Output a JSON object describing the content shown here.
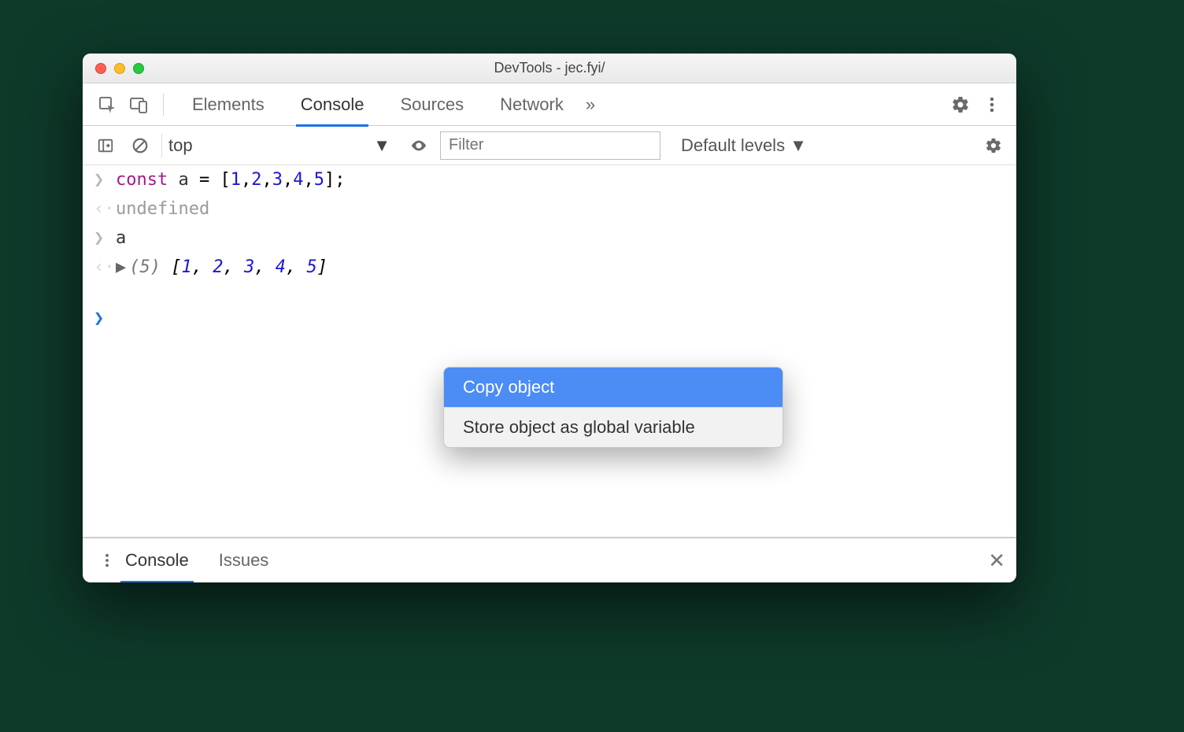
{
  "window": {
    "title": "DevTools - jec.fyi/"
  },
  "tabs": {
    "items": [
      "Elements",
      "Console",
      "Sources",
      "Network"
    ],
    "active": "Console"
  },
  "console_toolbar": {
    "context": "top",
    "filter_placeholder": "Filter",
    "levels_label": "Default levels"
  },
  "console": {
    "lines": [
      {
        "kind": "input",
        "text": "const a = [1,2,3,4,5];"
      },
      {
        "kind": "output",
        "text": "undefined"
      },
      {
        "kind": "input",
        "text": "a"
      },
      {
        "kind": "output_obj",
        "count": "(5)",
        "text": "[1, 2, 3, 4, 5]"
      },
      {
        "kind": "prompt",
        "text": ""
      }
    ]
  },
  "context_menu": {
    "items": [
      {
        "label": "Copy object",
        "highlighted": true
      },
      {
        "label": "Store object as global variable",
        "highlighted": false
      }
    ]
  },
  "drawer": {
    "tabs": [
      "Console",
      "Issues"
    ],
    "active": "Console"
  }
}
